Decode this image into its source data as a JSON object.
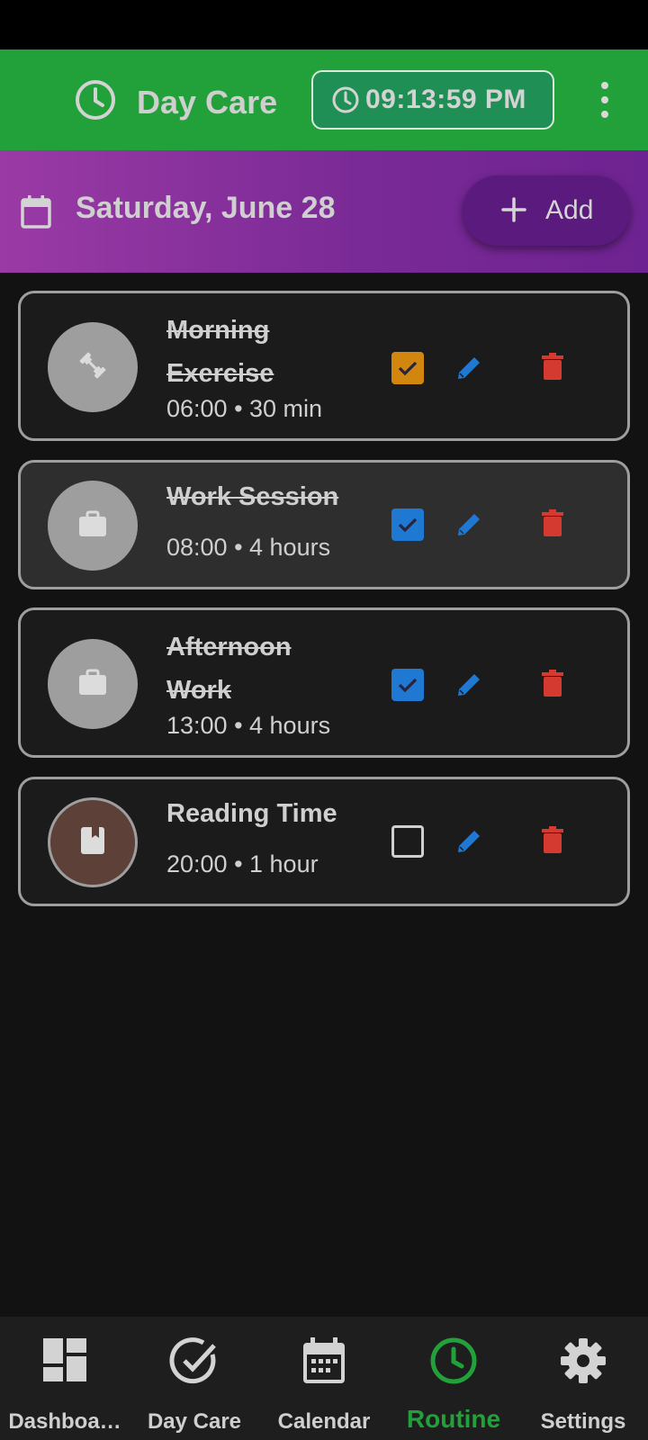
{
  "app": {
    "title": "Day Care",
    "clock": "09:13:59 PM",
    "accent_color": "#22a03a",
    "header_icon": "clock-icon",
    "menu_icon": "more-vert-icon"
  },
  "date_bar": {
    "date": "Saturday, June 28",
    "add_label": "Add",
    "icon": "calendar-icon"
  },
  "routines": [
    {
      "title_line1": "Morning",
      "title_line2": "Exercise",
      "meta": "06:00 • 30 min",
      "completed": true,
      "icon": "dumbbell-icon",
      "check_color": "#d1860e"
    },
    {
      "title_line1": "Work Session",
      "title_line2": "",
      "meta": "08:00 • 4 hours",
      "completed": true,
      "icon": "briefcase-icon",
      "check_color": "#1f78d1"
    },
    {
      "title_line1": "Afternoon",
      "title_line2": "Work",
      "meta": "13:00 • 4 hours",
      "completed": true,
      "icon": "briefcase-icon",
      "check_color": "#1f78d1"
    },
    {
      "title_line1": "Reading Time",
      "title_line2": "",
      "meta": "20:00 • 1 hour",
      "completed": false,
      "icon": "book-icon",
      "check_color": ""
    }
  ],
  "bottom_nav": [
    {
      "label": "Dashboa…",
      "icon": "dashboard-icon",
      "active": false
    },
    {
      "label": "Day Care",
      "icon": "check-circle-icon",
      "active": false
    },
    {
      "label": "Calendar",
      "icon": "calendar-icon",
      "active": false
    },
    {
      "label": "Routine",
      "icon": "clock-icon",
      "active": true
    },
    {
      "label": "Settings",
      "icon": "gear-icon",
      "active": false
    }
  ]
}
